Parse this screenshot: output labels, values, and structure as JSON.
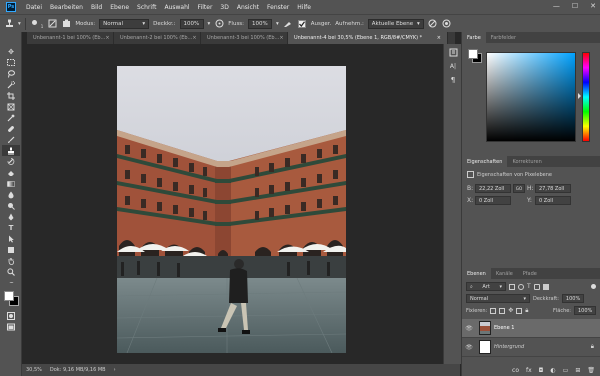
{
  "app": {
    "logo": "Ps"
  },
  "menu": [
    "Datei",
    "Bearbeiten",
    "Bild",
    "Ebene",
    "Schrift",
    "Auswahl",
    "Filter",
    "3D",
    "Ansicht",
    "Fenster",
    "Hilfe"
  ],
  "window_controls": {
    "minimize": "—",
    "maximize": "☐",
    "close": "✕"
  },
  "options": {
    "brush_size": "1",
    "mode_label": "Modus:",
    "mode_value": "Normal",
    "opacity_label": "Deckkr.:",
    "opacity_value": "100%",
    "flow_label": "Fluss:",
    "flow_value": "100%",
    "aligned_label": "Ausger.",
    "sample_label": "Aufnehm.:",
    "sample_value": "Aktuelle Ebene"
  },
  "tabs": [
    {
      "label": "Unbenannt-1 bei 100% (Eb...",
      "close": "×"
    },
    {
      "label": "Unbenannt-2 bei 100% (Eb...",
      "close": "×"
    },
    {
      "label": "Unbenannt-3 bei 100% (Eb...",
      "close": "×"
    },
    {
      "label": "Unbenannt-4 bei 30,5% (Ebene 1, RGB/8#/CMYK) *",
      "close": "×"
    }
  ],
  "status": {
    "zoom": "30,5%",
    "doc": "Dok: 9,16 MB/9,16 MB",
    "arrow": "›"
  },
  "color_panel": {
    "tabs": [
      "Farbe",
      "Farbfelder"
    ]
  },
  "properties": {
    "tabs": [
      "Eigenschaften",
      "Korrekturen"
    ],
    "title": "Eigenschaften von Pixelebene",
    "b_label": "B:",
    "b_value": "22,22 Zoll",
    "link": "GO",
    "h_label": "H:",
    "h_value": "27,78 Zoll",
    "x_label": "X:",
    "x_value": "0 Zoll",
    "y_label": "Y:",
    "y_value": "0 Zoll"
  },
  "layers": {
    "tabs": [
      "Ebenen",
      "Kanäle",
      "Pfade"
    ],
    "filter": "Art",
    "blend": "Normal",
    "opacity_label": "Deckkraft:",
    "opacity_value": "100%",
    "lock_label": "Fixieren:",
    "fill_label": "Fläche:",
    "fill_value": "100%",
    "items": [
      {
        "name": "Ebene 1"
      },
      {
        "name": "Hintergrund"
      }
    ],
    "footer_icons": [
      "co",
      "fx"
    ]
  },
  "colors": {
    "foreground": "#ffffff",
    "background": "#000000",
    "accent": "#31a8ff"
  }
}
